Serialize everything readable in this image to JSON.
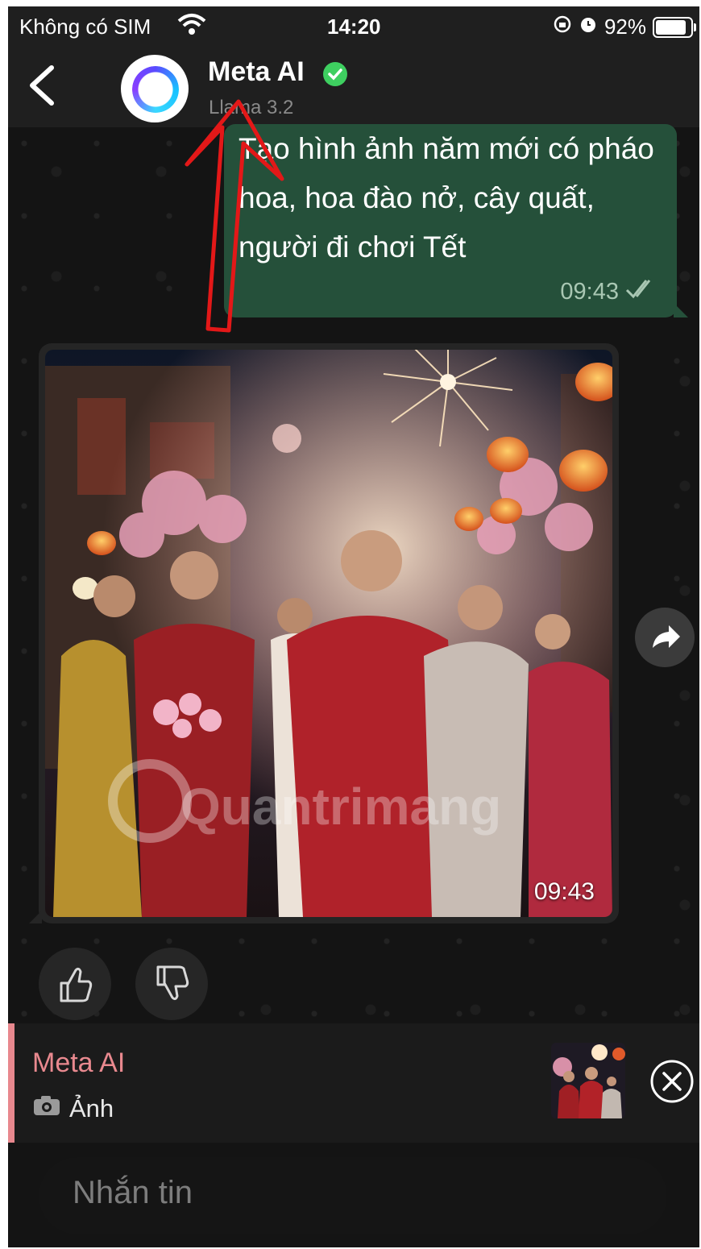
{
  "status_bar": {
    "carrier": "Không có SIM",
    "time": "14:20",
    "battery": "92%",
    "battery_level": 0.92
  },
  "header": {
    "title": "Meta AI",
    "subtitle": "Llama 3.2"
  },
  "messages": {
    "outgoing": {
      "text": "Tạo hình ảnh năm mới có pháo hoa, hoa đào nở, cây quất, người đi chơi Tết",
      "time": "09:43"
    },
    "image": {
      "time": "09:43",
      "watermark": "Quantrimang"
    }
  },
  "reply_preview": {
    "name": "Meta AI",
    "type_label": "Ảnh"
  },
  "composer": {
    "placeholder": "Nhắn tin"
  },
  "colors": {
    "outgoing_bubble": "#25503a",
    "reply_accent": "#e8888e",
    "verified": "#3ecf60",
    "annotation": "#e31818"
  }
}
